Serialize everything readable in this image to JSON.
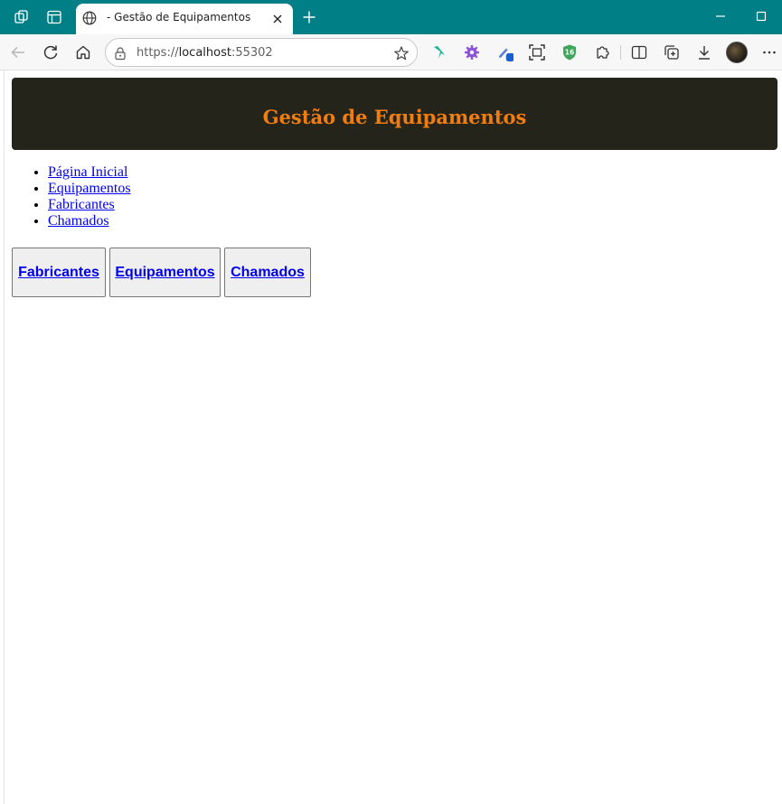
{
  "browser": {
    "tab_title": "- Gestão de Equipamentos",
    "url_scheme": "https://",
    "url_host": "localhost",
    "url_rest": ":55302",
    "extension_badge": "16",
    "icons": [
      "workspaces-icon",
      "tab-actions-icon",
      "globe-icon",
      "close-icon",
      "new-tab-icon",
      "minimize-icon",
      "maximize-icon",
      "back-icon",
      "refresh-icon",
      "home-icon",
      "lock-icon",
      "favorite-star-icon",
      "extension-icon",
      "split-screen-icon",
      "collections-icon",
      "downloads-icon",
      "more-icon"
    ]
  },
  "page": {
    "header_title": "Gestão de Equipamentos",
    "header_title_color": "#f07d10",
    "header_bg_color": "#24241b",
    "nav": [
      {
        "label": "Página Inicial"
      },
      {
        "label": "Equipamentos"
      },
      {
        "label": "Fabricantes"
      },
      {
        "label": "Chamados"
      }
    ],
    "buttons": [
      {
        "label": "Fabricantes"
      },
      {
        "label": "Equipamentos"
      },
      {
        "label": "Chamados"
      }
    ]
  }
}
